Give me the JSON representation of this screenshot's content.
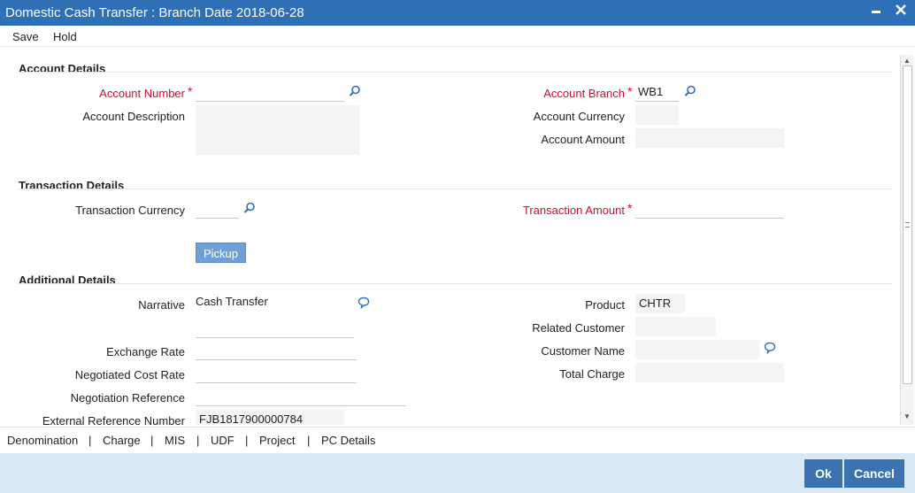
{
  "window": {
    "title": "Domestic Cash Transfer : Branch Date 2018-06-28",
    "minimize_glyph": "▬",
    "close_glyph": "✕"
  },
  "menu": {
    "save": "Save",
    "hold": "Hold"
  },
  "sections": {
    "account": "Account Details",
    "transaction": "Transaction Details",
    "additional": "Additional Details"
  },
  "account": {
    "number_label": "Account Number",
    "number_value": "",
    "description_label": "Account Description",
    "description_value": "",
    "branch_label": "Account Branch",
    "branch_value": "WB1",
    "currency_label": "Account Currency",
    "currency_value": "",
    "amount_label": "Account Amount",
    "amount_value": ""
  },
  "transaction": {
    "currency_label": "Transaction Currency",
    "currency_value": "",
    "amount_label": "Transaction Amount",
    "amount_value": "",
    "pickup_label": "Pickup"
  },
  "additional": {
    "narrative_label": "Narrative",
    "narrative_value": "Cash Transfer",
    "exchange_rate_label": "Exchange Rate",
    "exchange_rate_value": "",
    "negotiated_cost_rate_label": "Negotiated Cost Rate",
    "negotiated_cost_rate_value": "",
    "negotiation_reference_label": "Negotiation Reference",
    "negotiation_reference_value": "",
    "external_reference_label": "External Reference Number",
    "external_reference_value": "FJB1817900000784",
    "product_label": "Product",
    "product_value": "CHTR",
    "related_customer_label": "Related Customer",
    "related_customer_value": "",
    "customer_name_label": "Customer Name",
    "customer_name_value": "",
    "total_charge_label": "Total Charge",
    "total_charge_value": ""
  },
  "required_marker": "*",
  "tabs": [
    "Denomination",
    "Charge",
    "MIS",
    "UDF",
    "Project",
    "PC Details"
  ],
  "tab_separator": "|",
  "buttons": {
    "ok": "Ok",
    "cancel": "Cancel"
  },
  "colors": {
    "titlebar": "#2f6fb5",
    "required": "#c8102e",
    "button": "#3a73b0",
    "footer": "#d9e8f6",
    "pickup": "#6f9fd4"
  },
  "icons": {
    "search": "search-icon",
    "comment": "comment-icon"
  }
}
